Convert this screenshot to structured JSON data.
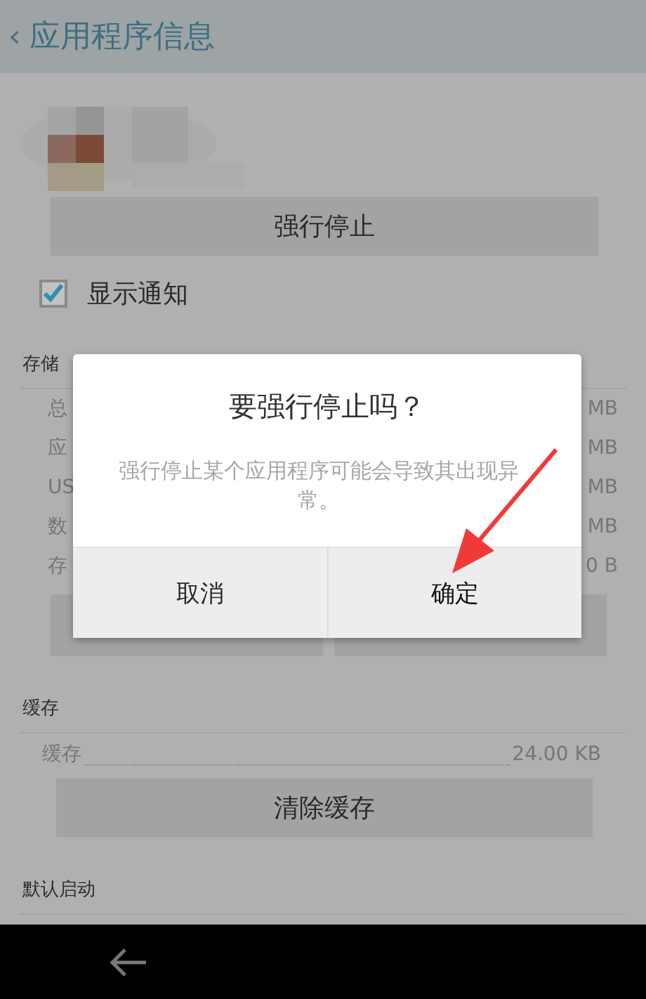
{
  "header": {
    "back": "‹",
    "title": "应用程序信息"
  },
  "force_stop_button": "强行停止",
  "notification": {
    "label": "显示通知",
    "checked": true
  },
  "storage": {
    "title": "存储",
    "rows": [
      {
        "label": "总",
        "value": "MB"
      },
      {
        "label": "应",
        "value": "MB"
      },
      {
        "label": "US",
        "value": "MB"
      },
      {
        "label": "数",
        "value": "MB"
      },
      {
        "label": "存",
        "value": "0 B"
      }
    ]
  },
  "cache": {
    "title": "缓存",
    "row": {
      "label": "缓存",
      "value": "24.00 KB"
    },
    "button": "清除缓存"
  },
  "default_launch": {
    "title": "默认启动"
  },
  "dialog": {
    "title": "要强行停止吗？",
    "message": "强行停止某个应用程序可能会导致其出现异常。",
    "buttons": [
      {
        "label": "取消",
        "kind": "cancel"
      },
      {
        "label": "确定",
        "kind": "confirm"
      }
    ]
  }
}
